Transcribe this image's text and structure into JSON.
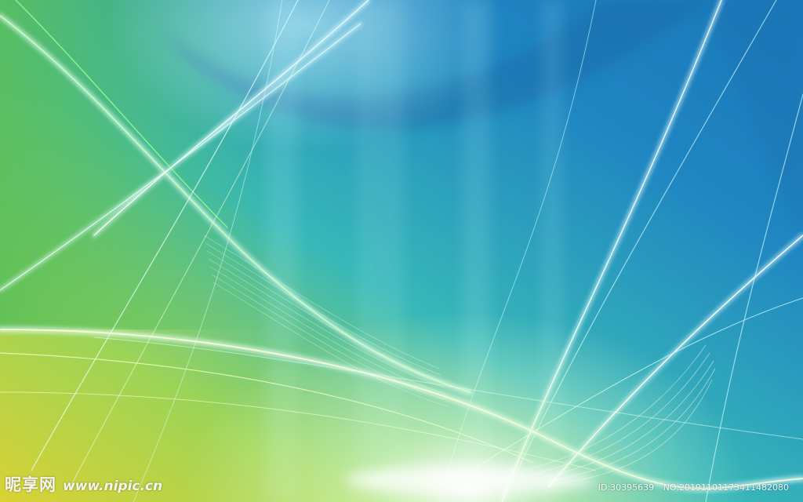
{
  "watermark": {
    "site_name": "昵享网",
    "site_url": "www.nipic.cn",
    "id_label": "ID:30395639",
    "no_label": "NO:20191101173411482080"
  },
  "colors": {
    "deep_blue": "#1f6fae",
    "teal": "#2fb3c8",
    "green": "#6fcf5a",
    "yellow": "#d8d636",
    "highlight": "#ffffff"
  }
}
